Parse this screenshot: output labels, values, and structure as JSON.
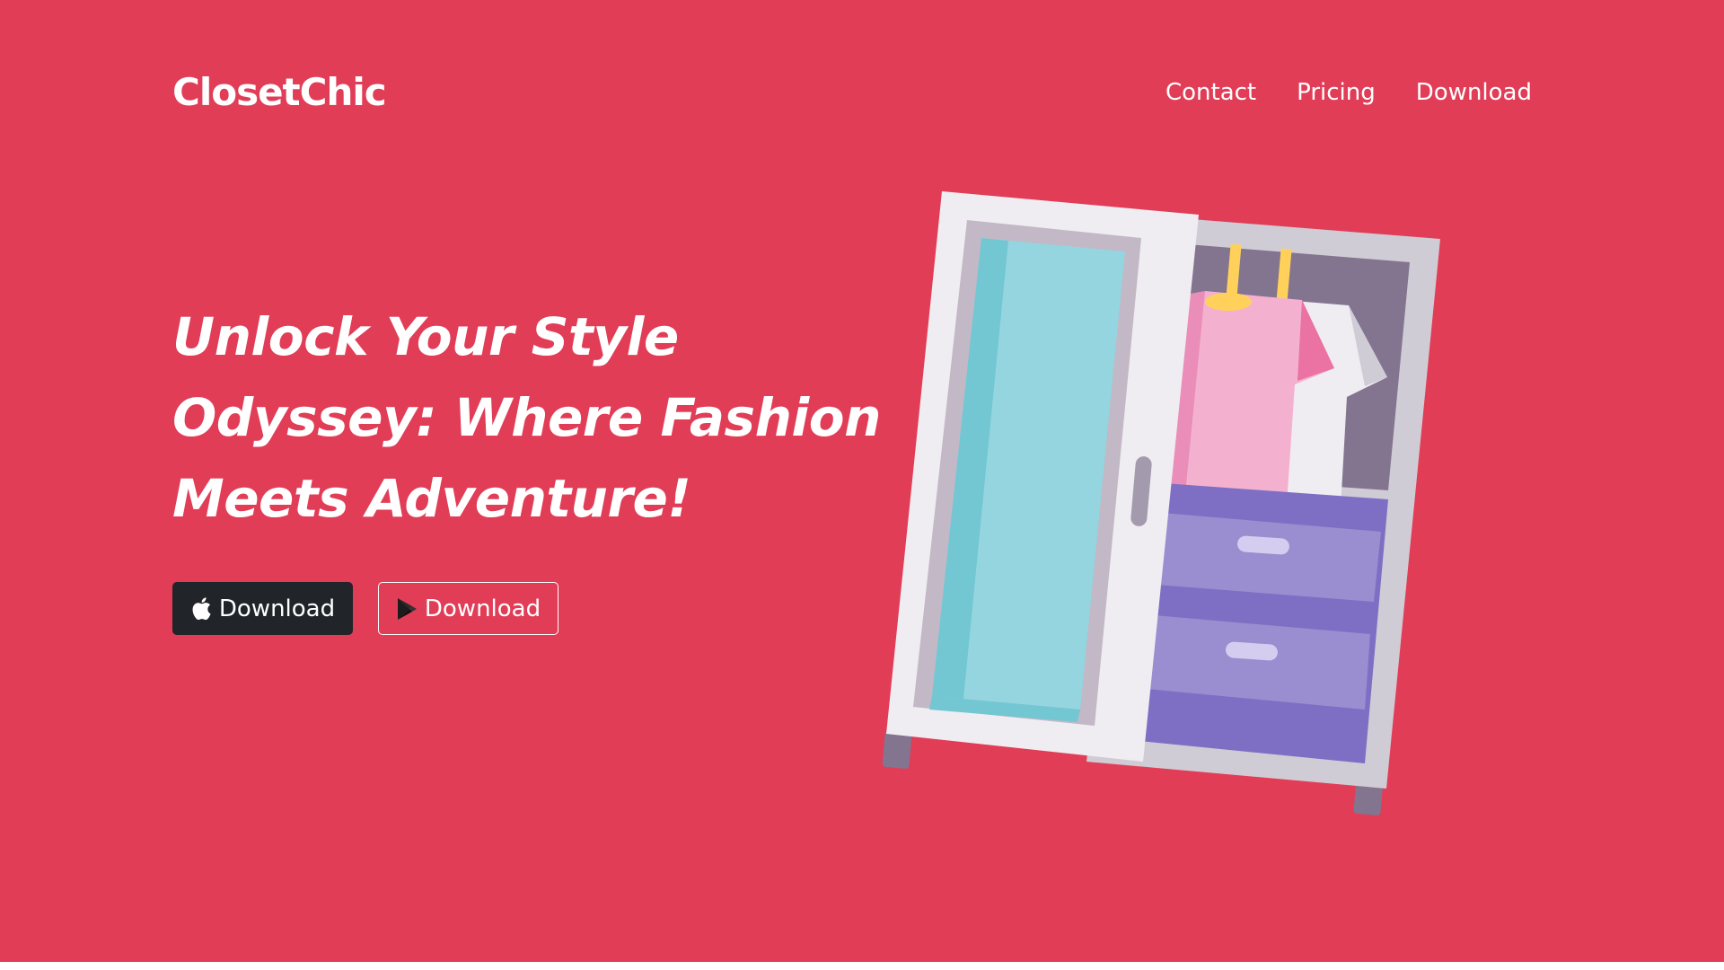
{
  "brand": {
    "name": "ClosetChic"
  },
  "nav": {
    "links": [
      {
        "label": "Contact"
      },
      {
        "label": "Pricing"
      },
      {
        "label": "Download"
      }
    ]
  },
  "hero": {
    "headline": "Unlock Your Style Odyssey: Where Fashion Meets Adventure!",
    "buttons": [
      {
        "label": "Download",
        "icon": "apple-icon",
        "style": "dark"
      },
      {
        "label": "Download",
        "icon": "google-play-icon",
        "style": "outline"
      }
    ],
    "illustration": "wardrobe-illustration"
  },
  "colors": {
    "background": "#e13d57",
    "text": "#ffffff",
    "dark_button": "#212529"
  }
}
